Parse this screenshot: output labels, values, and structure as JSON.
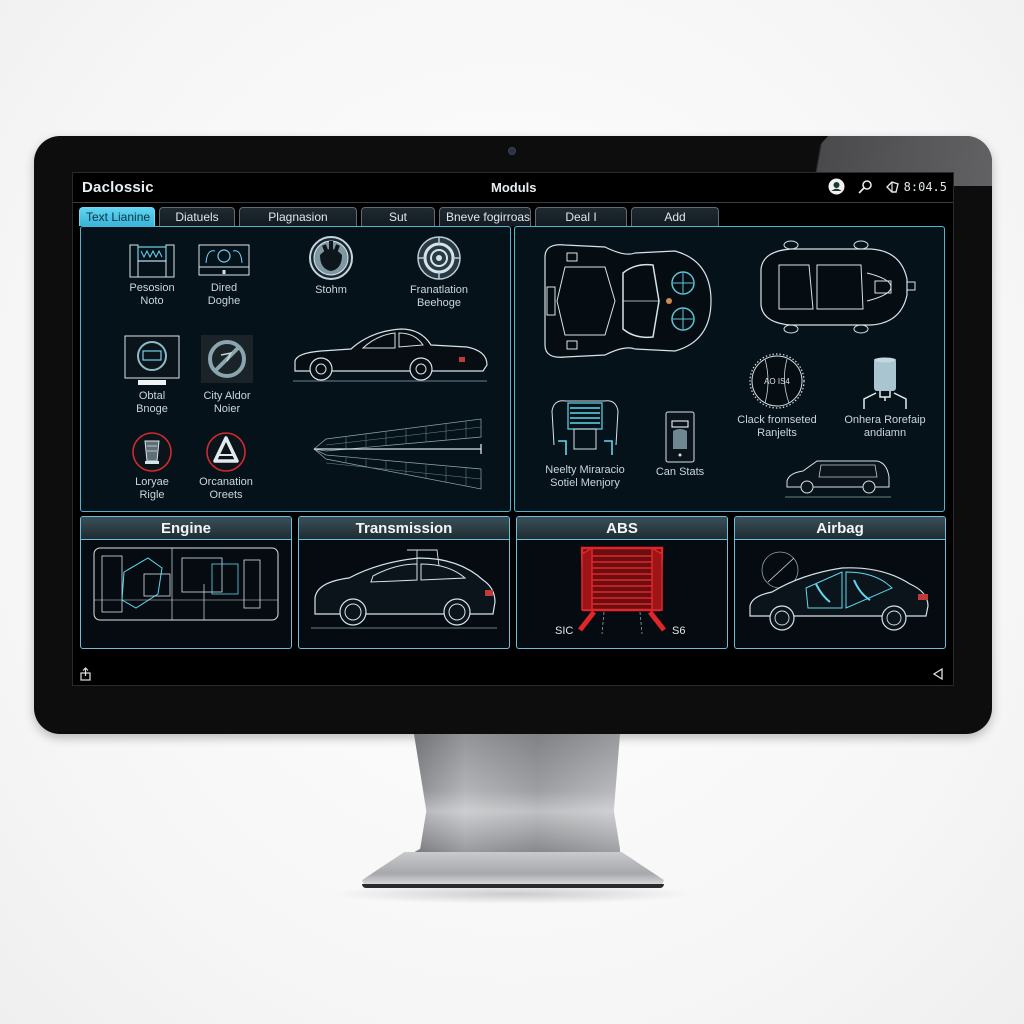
{
  "window": {
    "app_title": "Daclossic",
    "center_title": "Moduls",
    "clock": "8:04.5",
    "status_icons": [
      "profile-icon",
      "search-icon",
      "volume-icon"
    ]
  },
  "tabs": [
    {
      "label": "Text Lianine",
      "active": true
    },
    {
      "label": "Diatuels",
      "active": false
    },
    {
      "label": "Plagnasion",
      "active": false
    },
    {
      "label": "Sut",
      "active": false
    },
    {
      "label": "Bneve fogirroas",
      "active": false
    },
    {
      "label": "Deal I",
      "active": false
    },
    {
      "label": "Add",
      "active": false
    }
  ],
  "left_panel": {
    "items": [
      {
        "label_line1": "Pesosion",
        "label_line2": "Noto",
        "icon": "seat-module-icon"
      },
      {
        "label_line1": "Dired",
        "label_line2": "Doghe",
        "icon": "dashboard-icon"
      },
      {
        "label_line1": "Stohm",
        "label_line2": "",
        "icon": "steering-wheel-icon"
      },
      {
        "label_line1": "Franatlation",
        "label_line2": "Beehoge",
        "icon": "wheel-hub-icon"
      },
      {
        "label_line1": "Obtal",
        "label_line2": "Bnoge",
        "icon": "gauge-display-icon"
      },
      {
        "label_line1": "City Aldor",
        "label_line2": "Noier",
        "icon": "no-sign-icon"
      },
      {
        "label_line1": "Loryae",
        "label_line2": "Rigle",
        "icon": "piston-warning-icon"
      },
      {
        "label_line1": "Orcanation",
        "label_line2": "Oreets",
        "icon": "triangle-warning-icon"
      }
    ],
    "graphics": [
      "classic-car-side-view",
      "wireframe-beam-diagram"
    ]
  },
  "right_panel": {
    "items": [
      {
        "label_line1": "Clack fromseted",
        "label_line2": "Ranjelts",
        "icon": "compass-dial-icon",
        "dial_text": "AO IS4"
      },
      {
        "label_line1": "Onhera Rorefaip",
        "label_line2": "andiamn",
        "icon": "fluid-reservoir-icon"
      },
      {
        "label_line1": "Neelty Miraracio",
        "label_line2": "Sotiel Menjory",
        "icon": "seat-frame-icon"
      },
      {
        "label_line1": "Can Stats",
        "label_line2": "",
        "icon": "phone-stats-icon"
      }
    ],
    "graphics": [
      "car-chassis-top-view",
      "car-top-view",
      "minivan-side-view"
    ]
  },
  "modules": [
    {
      "title": "Engine",
      "graphic": "engine-schematic"
    },
    {
      "title": "Transmission",
      "graphic": "sedan-side-view"
    },
    {
      "title": "ABS",
      "graphic": "abs-unit-red",
      "label_left": "SIC",
      "label_right": "S6"
    },
    {
      "title": "Airbag",
      "graphic": "sedan-interior-view"
    }
  ],
  "footer": {
    "left_icon": "share-icon",
    "right_icon": "back-arrow-icon"
  },
  "colors": {
    "accent": "#53b4d1",
    "active_tab": "#4fc4e6",
    "abs_red": "#e0262b",
    "panel_bg": "#06121a"
  }
}
